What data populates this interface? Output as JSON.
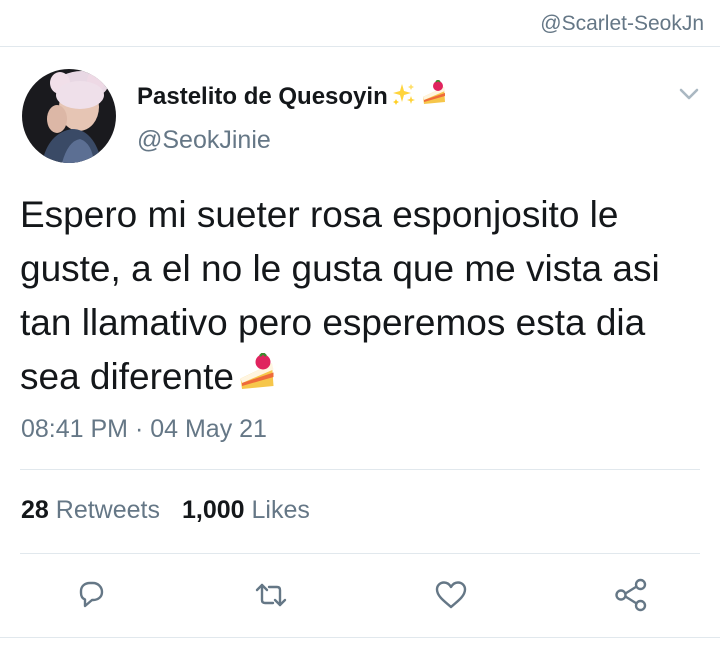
{
  "watermark": "@Scarlet-SeokJn",
  "author": {
    "display_name": "Pastelito de Quesoyin",
    "name_emojis": [
      "sparkles-icon",
      "cake-icon"
    ],
    "handle": "@SeokJinie",
    "avatar": "profile-photo"
  },
  "tweet": {
    "text": "Espero mi sueter rosa esponjosito le guste, a el no le gusta que me vista asi tan llamativo pero esperemos esta dia sea diferente",
    "trailing_emoji": "cake-icon",
    "timestamp": "08:41 PM · 04 May 21"
  },
  "stats": {
    "retweets_count": "28",
    "retweets_label": "Retweets",
    "likes_count": "1,000",
    "likes_label": "Likes"
  },
  "actions": [
    "reply-icon",
    "retweet-icon",
    "like-icon",
    "share-icon"
  ],
  "colors": {
    "text": "#14171a",
    "secondary": "#657786",
    "divider": "#e1e8ed",
    "icon": "#657786"
  }
}
